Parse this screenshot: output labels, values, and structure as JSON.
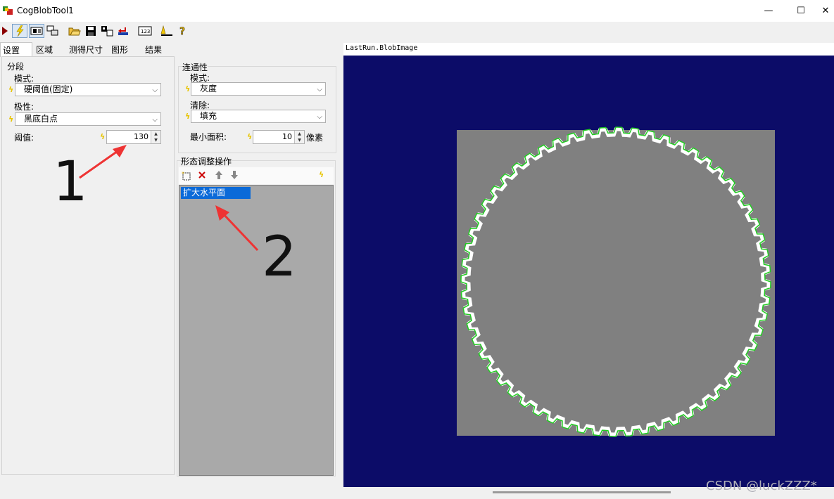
{
  "window": {
    "title": "CogBlobTool1",
    "minimize": "—",
    "maximize": "☐",
    "close": "✕"
  },
  "tabs": [
    "设置",
    "区域",
    "测得尺寸",
    "图形",
    "结果"
  ],
  "segmentation": {
    "group_title": "分段",
    "mode_label": "模式:",
    "mode_value": "硬阈值(固定)",
    "polarity_label": "极性:",
    "polarity_value": "黑底白点",
    "threshold_label": "阈值:",
    "threshold_value": "130"
  },
  "connectivity": {
    "group_title": "连通性",
    "mode_label": "模式:",
    "mode_value": "灰度",
    "cleanup_label": "清除:",
    "cleanup_value": "填充",
    "min_area_label": "最小面积:",
    "min_area_value": "10",
    "min_area_unit": "像素"
  },
  "morphology": {
    "group_title": "形态调整操作",
    "items": [
      "扩大水平面"
    ]
  },
  "display": {
    "label": "LastRun.BlobImage"
  },
  "annotations": {
    "one": "1",
    "two": "2"
  },
  "watermark": "CSDN @luckZZZ*",
  "colors": {
    "display_bg": "#0c0c68",
    "image_gray": "#808080",
    "blob_edge": "#22cc22",
    "selection": "#0b6ad8",
    "arrow": "#ee3333"
  }
}
